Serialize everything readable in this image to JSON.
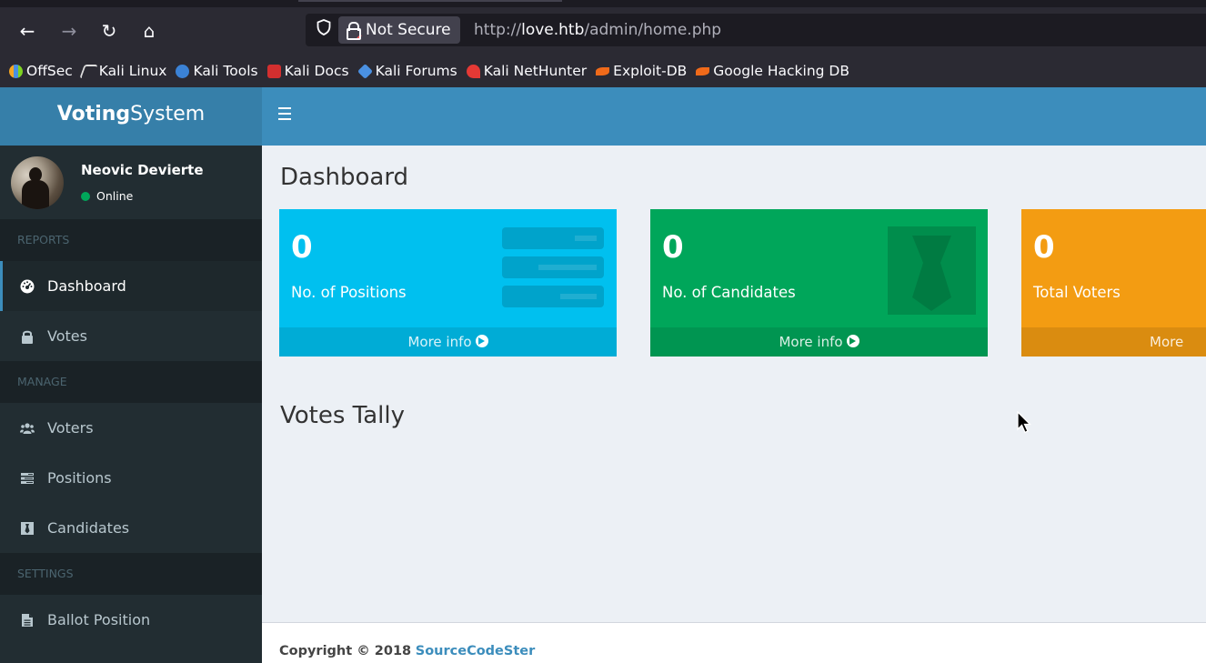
{
  "browser": {
    "security_label": "Not Secure",
    "url_prefix": "http://",
    "url_host": "love.htb",
    "url_path": "/admin/home.php",
    "bookmarks": [
      "OffSec",
      "Kali Linux",
      "Kali Tools",
      "Kali Docs",
      "Kali Forums",
      "Kali NetHunter",
      "Exploit-DB",
      "Google Hacking DB"
    ]
  },
  "brand": {
    "bold": "Voting",
    "rest": "System"
  },
  "user": {
    "name": "Neovic Devierte",
    "status": "Online"
  },
  "sidebar": {
    "sections": [
      "REPORTS",
      "MANAGE",
      "SETTINGS"
    ],
    "items": [
      "Dashboard",
      "Votes",
      "Voters",
      "Positions",
      "Candidates",
      "Ballot Position"
    ],
    "active": "Dashboard"
  },
  "page": {
    "title": "Dashboard",
    "votes_title": "Votes Tally"
  },
  "stats": [
    {
      "value": "0",
      "label": "No. of Positions",
      "more": "More info",
      "color": "#00c0ef"
    },
    {
      "value": "0",
      "label": "No. of Candidates",
      "more": "More info",
      "color": "#00a65a"
    },
    {
      "value": "0",
      "label": "Total Voters",
      "more": "More info",
      "color": "#f39c12"
    }
  ],
  "footer": {
    "copyright": "Copyright © 2018",
    "link": "SourceCodeSter"
  }
}
